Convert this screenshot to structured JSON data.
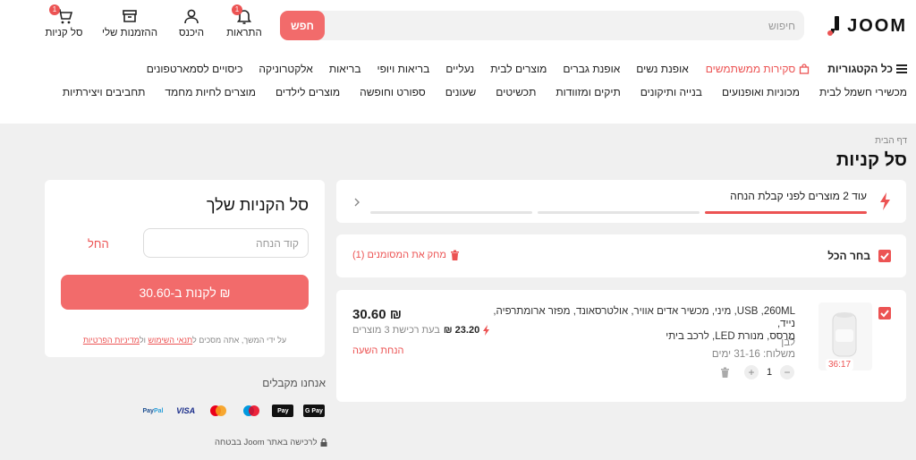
{
  "header": {
    "logo_text": "JOOM",
    "search_placeholder": "חיפוש",
    "search_button": "חפש",
    "icons": [
      {
        "label": "סל קניות",
        "icon": "cart-icon",
        "badge": "1"
      },
      {
        "label": "ההזמנות שלי",
        "icon": "box-icon",
        "badge": ""
      },
      {
        "label": "היכנס",
        "icon": "user-icon",
        "badge": ""
      },
      {
        "label": "התראות",
        "icon": "bell-icon",
        "badge": "1"
      }
    ]
  },
  "categories": {
    "all": "כל הקטגוריות",
    "sale": "סקירות ממשתמשים",
    "row1": [
      "נעליים",
      "בריאות ויופי",
      "בריאות",
      "אלקטרוניקה",
      "כיסויים לסמארטפונים"
    ],
    "row1_before": [
      "אופנת נשים",
      "אופנת גברים",
      "מוצרים לבית"
    ],
    "row2": [
      "מכשירי חשמל לבית",
      "מכוניות ואופנועים",
      "בנייה ותיקונים",
      "תיקים ומזוודות",
      "תכשיטים",
      "שעונים",
      "ספורט וחופשה",
      "מוצרים לילדים",
      "מוצרים לחיות מחמד",
      "תחביבים ויצירתיות"
    ]
  },
  "page": {
    "breadcrumb": "דף הבית",
    "title": "סל קניות"
  },
  "promo": {
    "text": "עוד 2 מוצרים לפני קבלת הנחה",
    "progress_filled": 1,
    "progress_total": 3
  },
  "select_all": {
    "label": "בחר הכל",
    "delete": "מחק את המסומנים (1)"
  },
  "item": {
    "timer": "36:17",
    "title_line1": "USB ,260ML, מיני, מכשיר אדים אוויר, אולטרסאונד, מפזר ארומתרפיה, נייד,",
    "title_line2": "מרסס, מנורת LED, לרכב ביתי",
    "color": "לבן",
    "shipping": "משלוח: 31-16 ימים",
    "quantity": "1",
    "price": "30.60 ₪",
    "bulk_price": "23.20 ₪",
    "bulk_note": "בעת רכישת 3 מוצרים",
    "discount_label": "הנחת השעה"
  },
  "summary": {
    "title": "סל הקניות שלך",
    "promo_placeholder": "קוד הנחה",
    "apply": "החל",
    "buy_button": "לקנות ב-30.60 ₪",
    "legal_prefix": "על ידי המשך, אתה מסכים ל",
    "legal_terms": "תנאי השימוש",
    "legal_and": " ול",
    "legal_privacy": "מדיניות הפרטיות"
  },
  "payments": {
    "title": "אנחנו מקבלים",
    "methods": [
      "PayPal",
      "VISA",
      "Mastercard",
      "Maestro",
      "Apple Pay",
      "G Pay"
    ]
  },
  "secure": "לרכישה באתר Joom בבטחה",
  "colors": {
    "accent": "#ec5353",
    "button": "#f26b6b",
    "background": "#f0f0f0"
  }
}
